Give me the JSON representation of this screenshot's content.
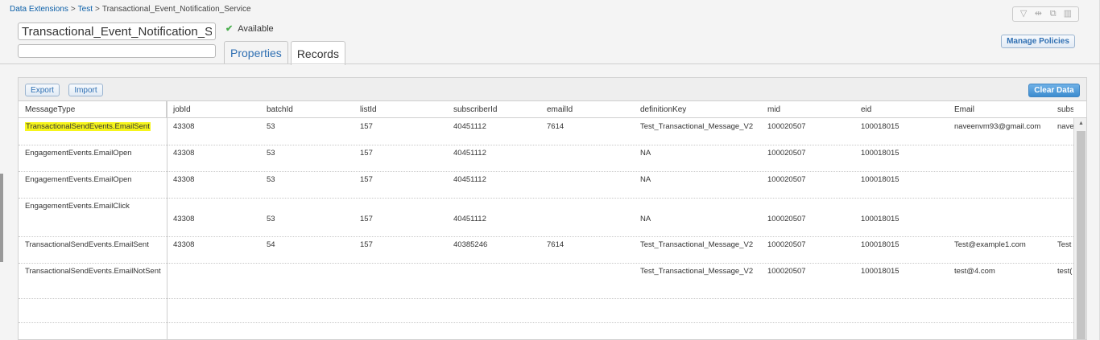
{
  "breadcrumb": {
    "items": [
      "Data Extensions",
      "Test",
      "Transactional_Event_Notification_Service"
    ],
    "separator": ">"
  },
  "name_input": {
    "value": "Transactional_Event_Notification_Ser"
  },
  "status": {
    "text": "Available"
  },
  "tabs": [
    {
      "label": "Properties"
    },
    {
      "label": "Records"
    }
  ],
  "toolbar": {
    "manage_policies": "Manage Policies",
    "icons": [
      "filter-icon",
      "swap-icon",
      "copy-icon",
      "trash-icon"
    ]
  },
  "records": {
    "export_label": "Export",
    "import_label": "Import",
    "clear_label": "Clear Data",
    "columns": [
      "MessageType",
      "jobId",
      "batchId",
      "listId",
      "subscriberId",
      "emailId",
      "definitionKey",
      "mid",
      "eid",
      "Email",
      "subscrib"
    ],
    "rows": [
      [
        "TransactionalSendEvents.EmailSent",
        "43308",
        "53",
        "157",
        "40451112",
        "7614",
        "Test_Transactional_Message_V2",
        "100020507",
        "100018015",
        "naveenvm93@gmail.com",
        "nave"
      ],
      [
        "EngagementEvents.EmailOpen",
        "43308",
        "53",
        "157",
        "40451112",
        "",
        "NA",
        "100020507",
        "100018015",
        "",
        ""
      ],
      [
        "EngagementEvents.EmailOpen",
        "43308",
        "53",
        "157",
        "40451112",
        "",
        "NA",
        "100020507",
        "100018015",
        "",
        ""
      ],
      [
        "EngagementEvents.EmailClick",
        "43308",
        "53",
        "157",
        "40451112",
        "",
        "NA",
        "100020507",
        "100018015",
        "",
        ""
      ],
      [
        "TransactionalSendEvents.EmailSent",
        "43308",
        "54",
        "157",
        "40385246",
        "7614",
        "Test_Transactional_Message_V2",
        "100020507",
        "100018015",
        "Test@example1.com",
        "Test"
      ],
      [
        "TransactionalSendEvents.EmailNotSent",
        "",
        "",
        "",
        "",
        "",
        "Test_Transactional_Message_V2",
        "100020507",
        "100018015",
        "test@4.com",
        "test("
      ]
    ]
  },
  "colors": {
    "link": "#0b5fa8",
    "highlight": "#f6f51b",
    "clear_button": "#3c8ccf"
  }
}
